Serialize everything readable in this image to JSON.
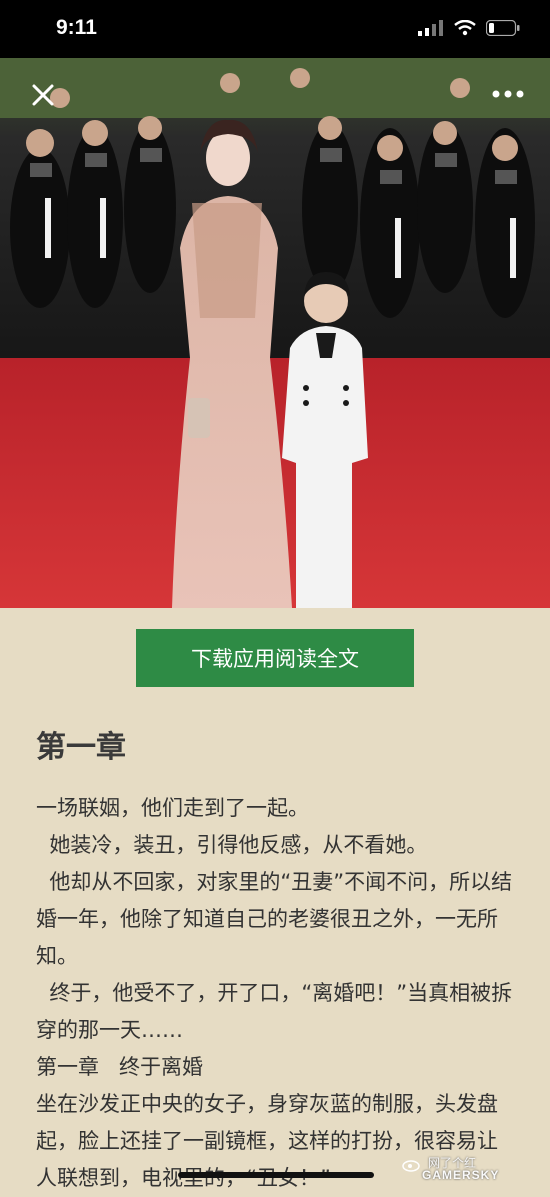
{
  "status_bar": {
    "time": "9:11"
  },
  "toolbar": {
    "close_icon": "close-icon",
    "more_icon": "more-icon"
  },
  "cta": {
    "label": "下载应用阅读全文",
    "color": "#2e8b45"
  },
  "chapter": {
    "title": "第一章"
  },
  "article": {
    "paragraphs": [
      "一场联姻，他们走到了一起。",
      "  她装冷，装丑，引得他反感，从不看她。",
      "  他却从不回家，对家里的“丑妻”不闻不问，所以结婚一年，他除了知道自己的老婆很丑之外，一无所知。",
      "  终于，他受不了，开了口，“离婚吧！”当真相被拆穿的那一天……",
      "第一章   终于离婚",
      "坐在沙发正中央的女子，身穿灰蓝的制服，头发盘起，脸上还挂了一副镜框，这样的打扮，很容易让人联想到，电视里的，“丑女！”"
    ]
  },
  "watermark": {
    "text": "网了个红",
    "brand": "GAMERSKY"
  },
  "colors": {
    "background": "#e6dcc4",
    "text": "#333333"
  }
}
